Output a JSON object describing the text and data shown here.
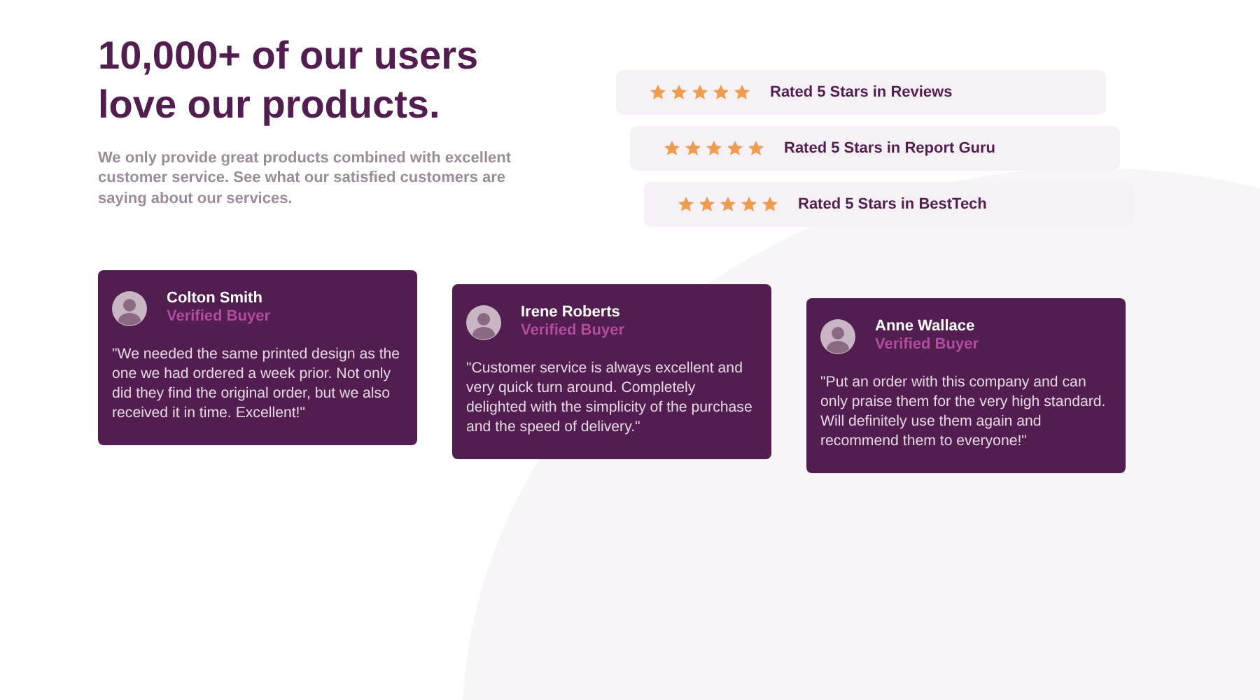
{
  "headline": "**10,000+** of our users love our products.",
  "intro": "We only provide great products combined with excellent customer service. See what our satisfied customers are saying about our services.",
  "ratings": [
    {
      "stars": 5,
      "label": "Rated 5 Stars in Reviews"
    },
    {
      "stars": 5,
      "label": "Rated 5 Stars in Report Guru"
    },
    {
      "stars": 5,
      "label": "Rated 5 Stars in BestTech"
    }
  ],
  "testimonials": [
    {
      "name": "Colton Smith",
      "status": "Verified Buyer",
      "quote": "\"We needed the same printed design as the one we had ordered a week prior. Not only did they find the original order, but we also received it in time. Excellent!\""
    },
    {
      "name": "Irene Roberts",
      "status": "Verified Buyer",
      "quote": "\"Customer service is always excellent and very quick turn around. Completely delighted with the simplicity of the purchase and the speed of delivery.\""
    },
    {
      "name": "Anne Wallace",
      "status": "Verified Buyer",
      "quote": "\"Put an order with this company and can only praise them for the very high standard. Will definitely use them again and recommend them to everyone!\""
    }
  ]
}
